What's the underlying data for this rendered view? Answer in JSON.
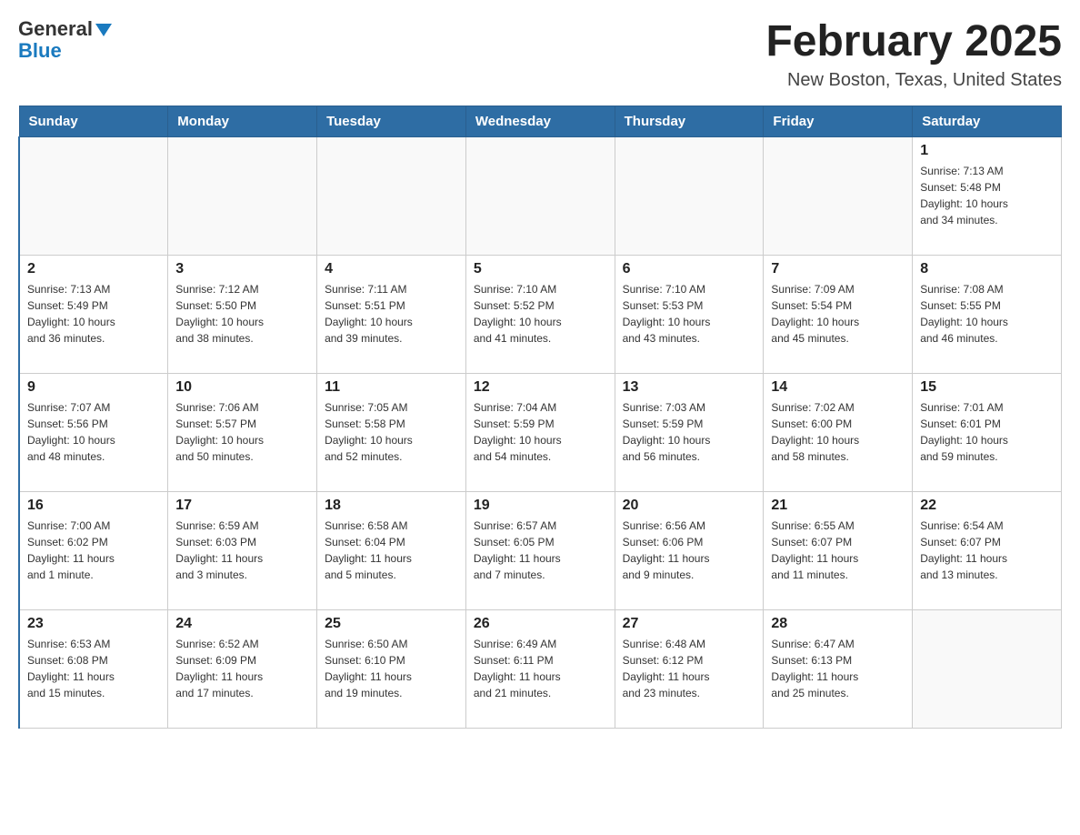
{
  "header": {
    "logo_general": "General",
    "logo_blue": "Blue",
    "main_title": "February 2025",
    "subtitle": "New Boston, Texas, United States"
  },
  "days_of_week": [
    "Sunday",
    "Monday",
    "Tuesday",
    "Wednesday",
    "Thursday",
    "Friday",
    "Saturday"
  ],
  "weeks": [
    {
      "days": [
        {
          "number": "",
          "info": ""
        },
        {
          "number": "",
          "info": ""
        },
        {
          "number": "",
          "info": ""
        },
        {
          "number": "",
          "info": ""
        },
        {
          "number": "",
          "info": ""
        },
        {
          "number": "",
          "info": ""
        },
        {
          "number": "1",
          "info": "Sunrise: 7:13 AM\nSunset: 5:48 PM\nDaylight: 10 hours\nand 34 minutes."
        }
      ]
    },
    {
      "days": [
        {
          "number": "2",
          "info": "Sunrise: 7:13 AM\nSunset: 5:49 PM\nDaylight: 10 hours\nand 36 minutes."
        },
        {
          "number": "3",
          "info": "Sunrise: 7:12 AM\nSunset: 5:50 PM\nDaylight: 10 hours\nand 38 minutes."
        },
        {
          "number": "4",
          "info": "Sunrise: 7:11 AM\nSunset: 5:51 PM\nDaylight: 10 hours\nand 39 minutes."
        },
        {
          "number": "5",
          "info": "Sunrise: 7:10 AM\nSunset: 5:52 PM\nDaylight: 10 hours\nand 41 minutes."
        },
        {
          "number": "6",
          "info": "Sunrise: 7:10 AM\nSunset: 5:53 PM\nDaylight: 10 hours\nand 43 minutes."
        },
        {
          "number": "7",
          "info": "Sunrise: 7:09 AM\nSunset: 5:54 PM\nDaylight: 10 hours\nand 45 minutes."
        },
        {
          "number": "8",
          "info": "Sunrise: 7:08 AM\nSunset: 5:55 PM\nDaylight: 10 hours\nand 46 minutes."
        }
      ]
    },
    {
      "days": [
        {
          "number": "9",
          "info": "Sunrise: 7:07 AM\nSunset: 5:56 PM\nDaylight: 10 hours\nand 48 minutes."
        },
        {
          "number": "10",
          "info": "Sunrise: 7:06 AM\nSunset: 5:57 PM\nDaylight: 10 hours\nand 50 minutes."
        },
        {
          "number": "11",
          "info": "Sunrise: 7:05 AM\nSunset: 5:58 PM\nDaylight: 10 hours\nand 52 minutes."
        },
        {
          "number": "12",
          "info": "Sunrise: 7:04 AM\nSunset: 5:59 PM\nDaylight: 10 hours\nand 54 minutes."
        },
        {
          "number": "13",
          "info": "Sunrise: 7:03 AM\nSunset: 5:59 PM\nDaylight: 10 hours\nand 56 minutes."
        },
        {
          "number": "14",
          "info": "Sunrise: 7:02 AM\nSunset: 6:00 PM\nDaylight: 10 hours\nand 58 minutes."
        },
        {
          "number": "15",
          "info": "Sunrise: 7:01 AM\nSunset: 6:01 PM\nDaylight: 10 hours\nand 59 minutes."
        }
      ]
    },
    {
      "days": [
        {
          "number": "16",
          "info": "Sunrise: 7:00 AM\nSunset: 6:02 PM\nDaylight: 11 hours\nand 1 minute."
        },
        {
          "number": "17",
          "info": "Sunrise: 6:59 AM\nSunset: 6:03 PM\nDaylight: 11 hours\nand 3 minutes."
        },
        {
          "number": "18",
          "info": "Sunrise: 6:58 AM\nSunset: 6:04 PM\nDaylight: 11 hours\nand 5 minutes."
        },
        {
          "number": "19",
          "info": "Sunrise: 6:57 AM\nSunset: 6:05 PM\nDaylight: 11 hours\nand 7 minutes."
        },
        {
          "number": "20",
          "info": "Sunrise: 6:56 AM\nSunset: 6:06 PM\nDaylight: 11 hours\nand 9 minutes."
        },
        {
          "number": "21",
          "info": "Sunrise: 6:55 AM\nSunset: 6:07 PM\nDaylight: 11 hours\nand 11 minutes."
        },
        {
          "number": "22",
          "info": "Sunrise: 6:54 AM\nSunset: 6:07 PM\nDaylight: 11 hours\nand 13 minutes."
        }
      ]
    },
    {
      "days": [
        {
          "number": "23",
          "info": "Sunrise: 6:53 AM\nSunset: 6:08 PM\nDaylight: 11 hours\nand 15 minutes."
        },
        {
          "number": "24",
          "info": "Sunrise: 6:52 AM\nSunset: 6:09 PM\nDaylight: 11 hours\nand 17 minutes."
        },
        {
          "number": "25",
          "info": "Sunrise: 6:50 AM\nSunset: 6:10 PM\nDaylight: 11 hours\nand 19 minutes."
        },
        {
          "number": "26",
          "info": "Sunrise: 6:49 AM\nSunset: 6:11 PM\nDaylight: 11 hours\nand 21 minutes."
        },
        {
          "number": "27",
          "info": "Sunrise: 6:48 AM\nSunset: 6:12 PM\nDaylight: 11 hours\nand 23 minutes."
        },
        {
          "number": "28",
          "info": "Sunrise: 6:47 AM\nSunset: 6:13 PM\nDaylight: 11 hours\nand 25 minutes."
        },
        {
          "number": "",
          "info": ""
        }
      ]
    }
  ]
}
